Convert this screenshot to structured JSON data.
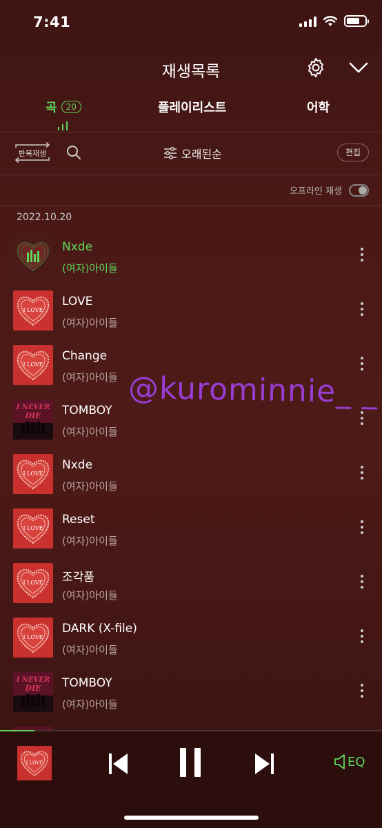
{
  "status_bar": {
    "time": "7:41"
  },
  "header": {
    "title": "재생목록"
  },
  "tabs": [
    {
      "label": "곡",
      "count": "20",
      "active": true
    },
    {
      "label": "플레이리스트"
    },
    {
      "label": "어학"
    }
  ],
  "toolbar": {
    "repeat_label": "반복재생",
    "sort_label": "오래된순",
    "edit_label": "편집"
  },
  "offline": {
    "label": "오프라인 재생"
  },
  "date_header": "2022.10.20",
  "songs": [
    {
      "title": "Nxde",
      "artist": "(여자)아이들",
      "cover": "heart-playing",
      "playing": true
    },
    {
      "title": "LOVE",
      "artist": "(여자)아이들",
      "cover": "i-love"
    },
    {
      "title": "Change",
      "artist": "(여자)아이들",
      "cover": "i-love"
    },
    {
      "title": "TOMBOY",
      "artist": "(여자)아이들",
      "cover": "i-never-die"
    },
    {
      "title": "Nxde",
      "artist": "(여자)아이들",
      "cover": "i-love"
    },
    {
      "title": "Reset",
      "artist": "(여자)아이들",
      "cover": "i-love"
    },
    {
      "title": "조각품",
      "artist": "(여자)아이들",
      "cover": "i-love"
    },
    {
      "title": "DARK (X-file)",
      "artist": "(여자)아이들",
      "cover": "i-love"
    },
    {
      "title": "TOMBOY",
      "artist": "(여자)아이들",
      "cover": "i-never-die"
    }
  ],
  "watermark": "@kurominnie_ _",
  "player": {
    "progress": 0.09,
    "eq_label": "EQ",
    "accent": "#5fd75a"
  },
  "colors": {
    "accent": "#5fd75a",
    "cover_red": "#c8312e",
    "background": "#4a1916"
  },
  "cover_text": {
    "love": "I LOVE",
    "never_die": "I NEVER DIE"
  }
}
